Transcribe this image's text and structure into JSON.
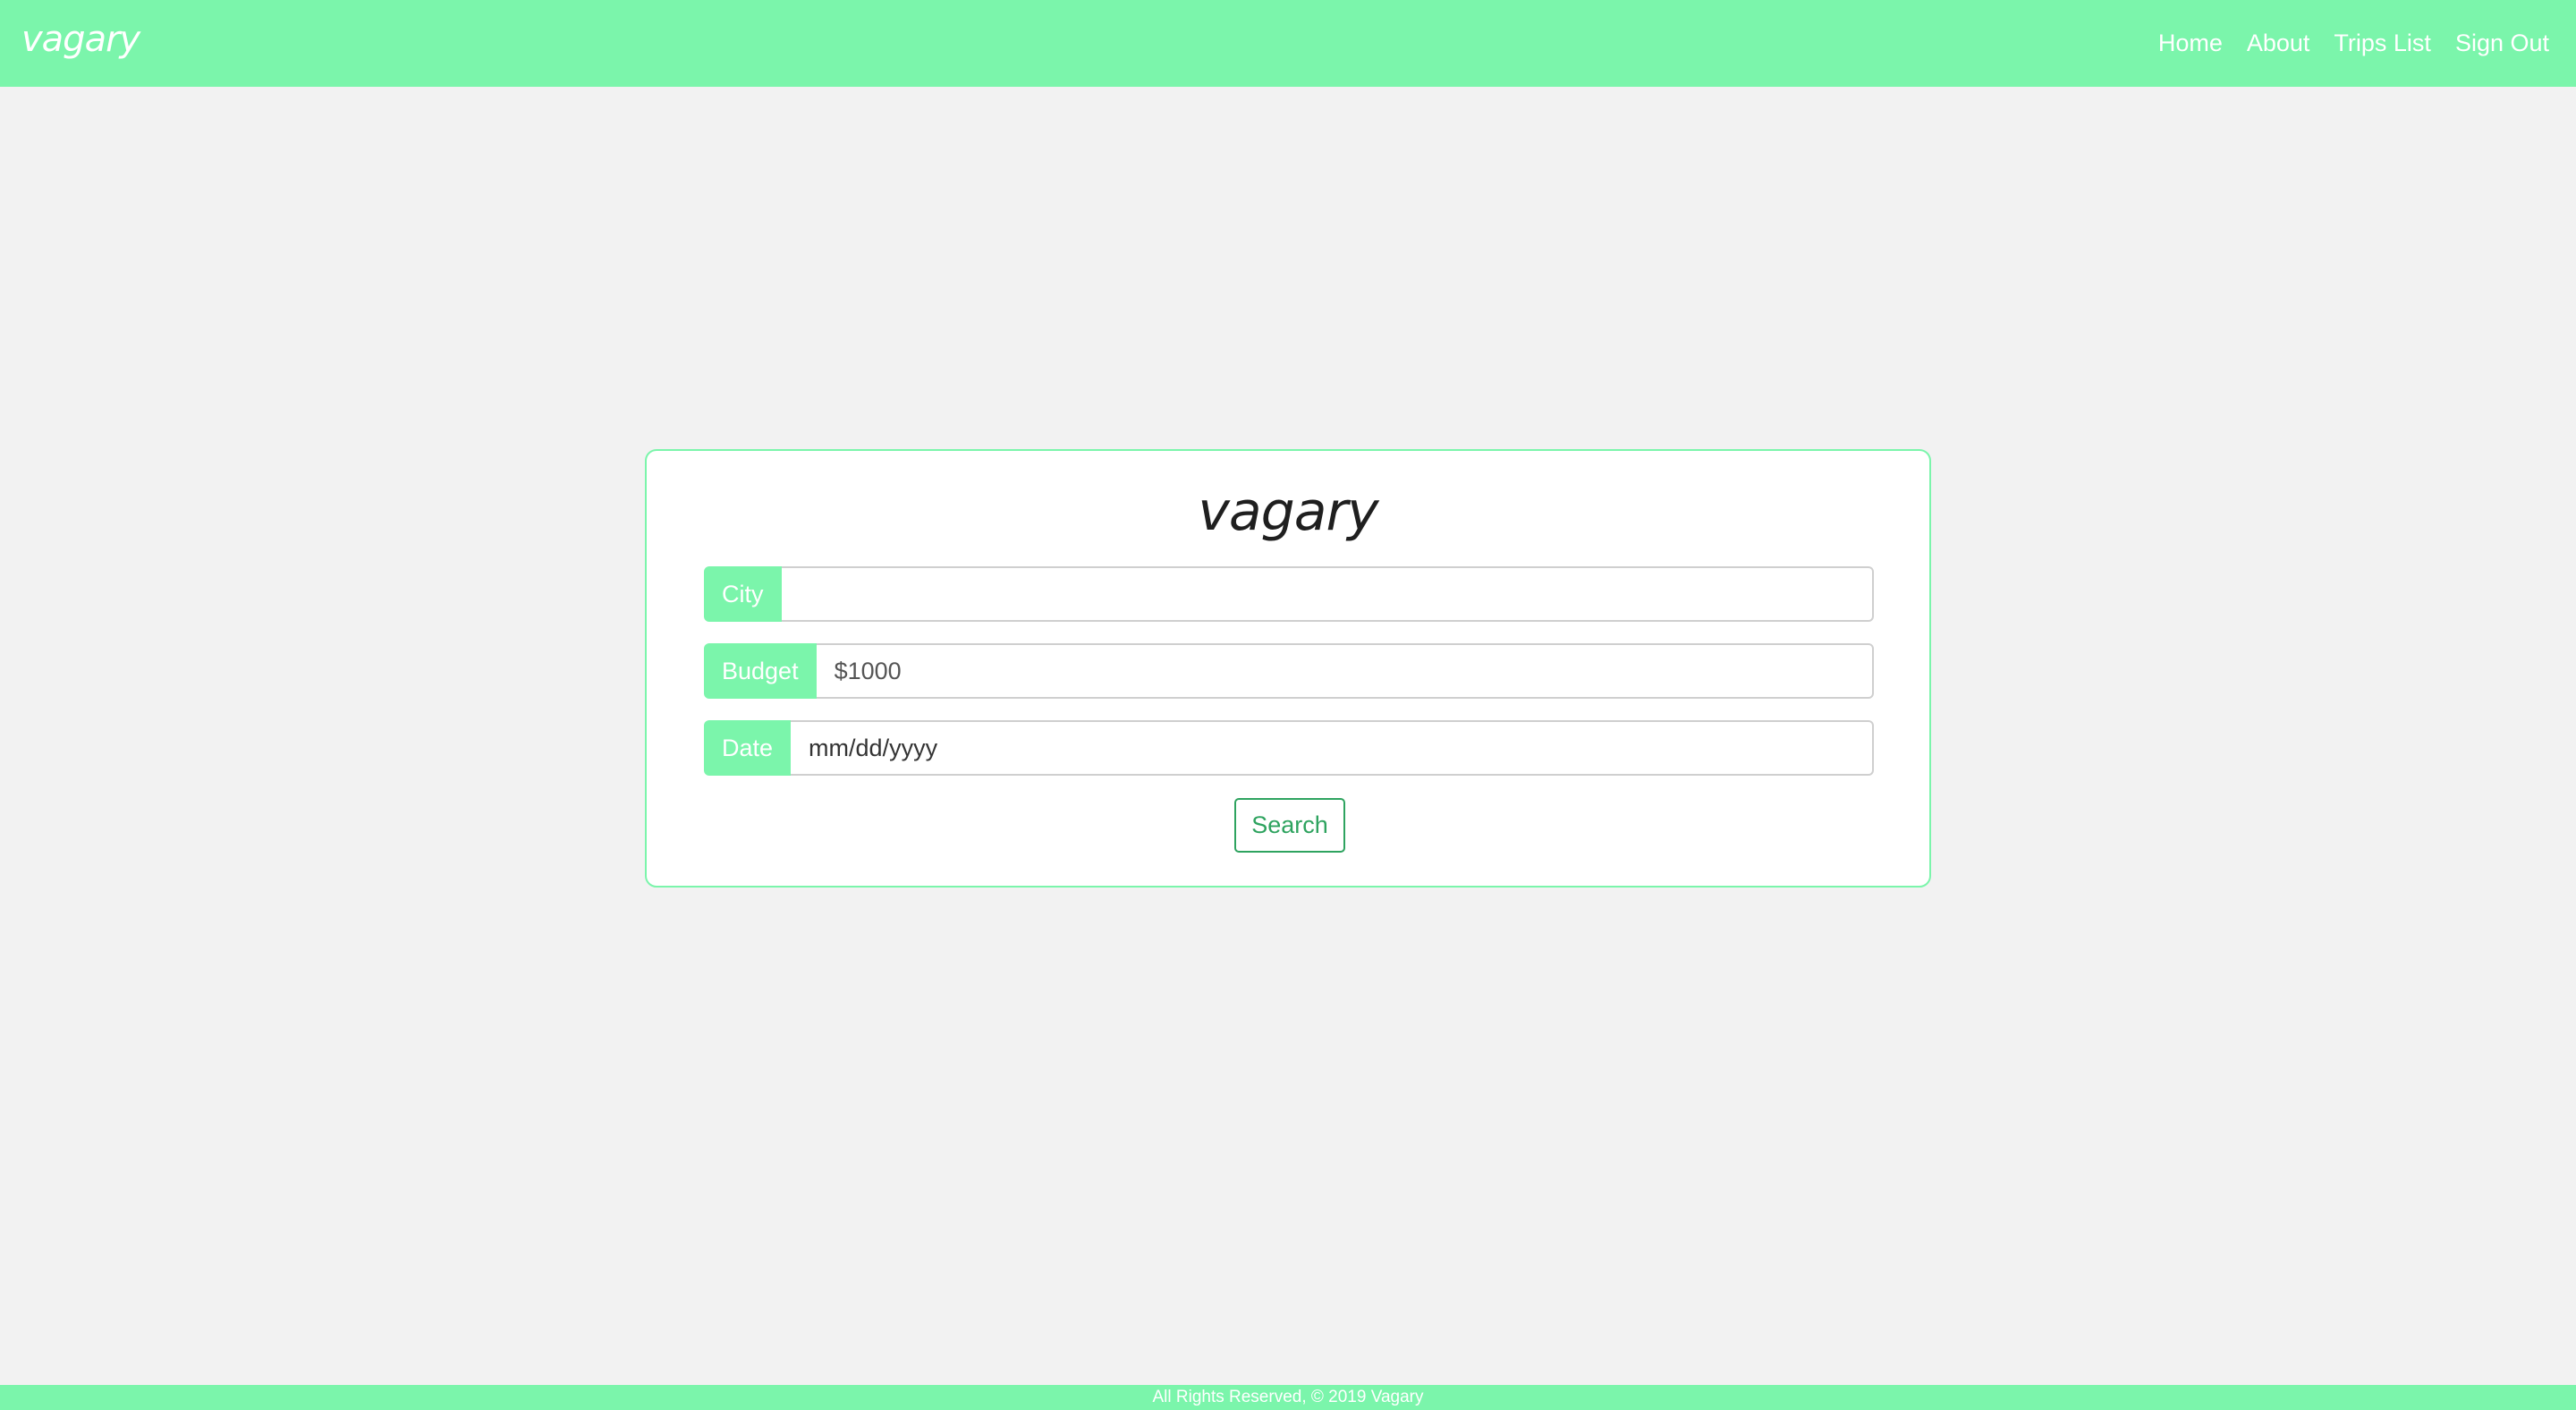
{
  "navbar": {
    "brand": "vagary",
    "links": [
      "Home",
      "About",
      "Trips List",
      "Sign Out"
    ]
  },
  "search_card": {
    "title": "vagary",
    "city": {
      "label": "City",
      "value": "",
      "placeholder": ""
    },
    "budget": {
      "label": "Budget",
      "value": "",
      "placeholder": "$1000"
    },
    "date": {
      "label": "Date",
      "value": "mm/dd/yyyy"
    },
    "search_label": "Search"
  },
  "footer": {
    "text": "All Rights Reserved, © 2019 Vagary"
  },
  "colors": {
    "accent": "#7bf5ab",
    "button": "#2ea35f",
    "background": "#f2f2f2"
  }
}
